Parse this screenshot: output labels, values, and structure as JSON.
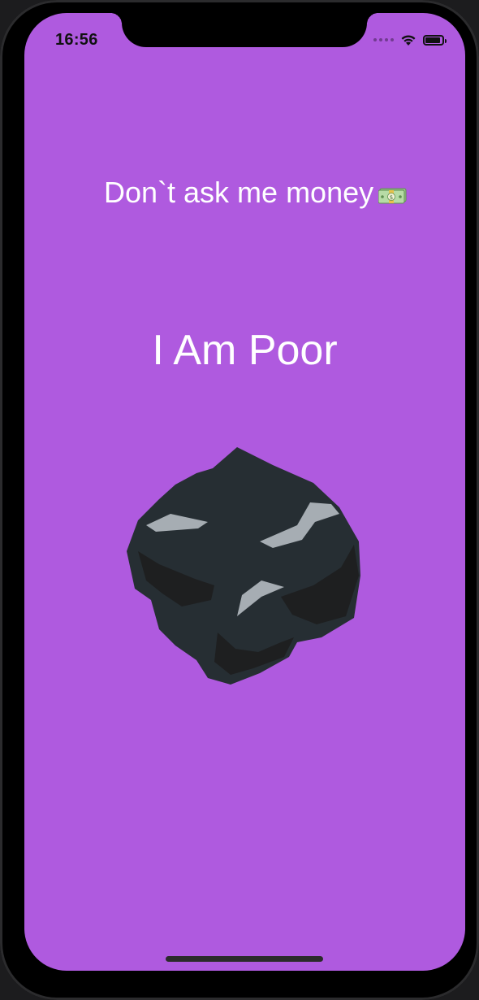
{
  "status_bar": {
    "time": "16:56",
    "battery_level": 0.9
  },
  "content": {
    "subtitle": "Don`t ask me money",
    "title": "I Am Poor",
    "image_icon": "coal-icon",
    "money_icon": "money-with-wings-icon"
  },
  "colors": {
    "background": "#AF5ADF",
    "text": "#FFFFFF",
    "coal_base": "#262E33",
    "coal_shadow": "#1E1F20",
    "coal_highlight": "#A6ADB3"
  }
}
